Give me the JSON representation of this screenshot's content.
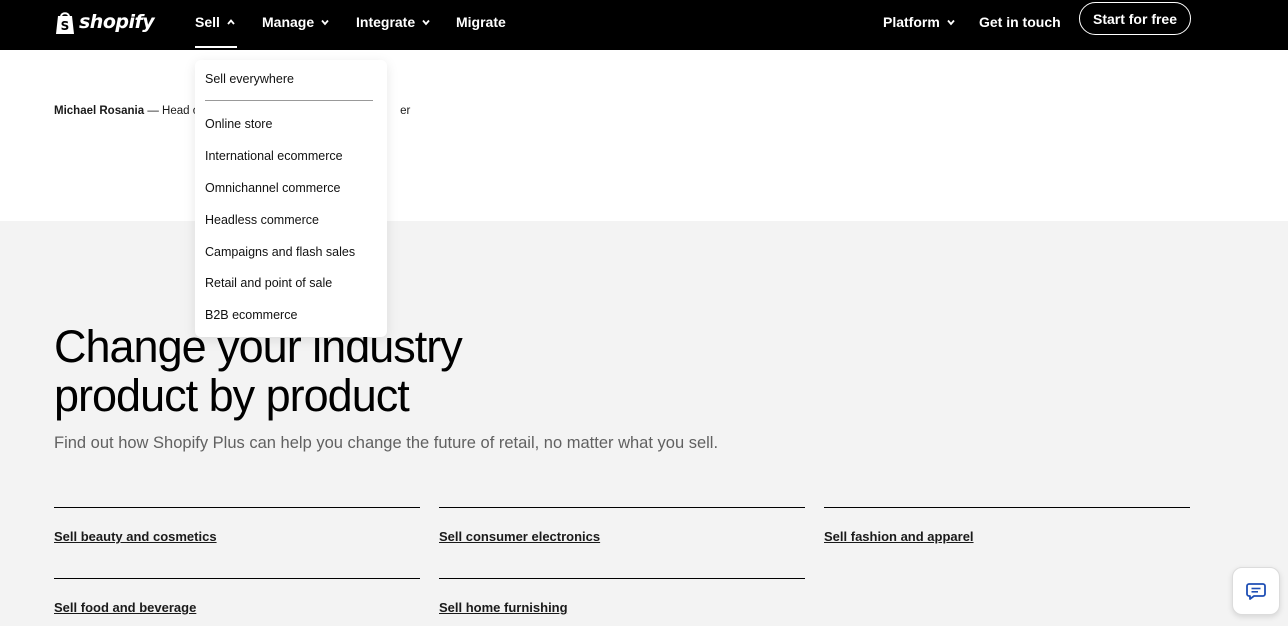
{
  "nav": {
    "logo_text": "shopify",
    "items": [
      {
        "label": "Sell"
      },
      {
        "label": "Manage"
      },
      {
        "label": "Integrate"
      },
      {
        "label": "Migrate"
      }
    ],
    "right": {
      "platform": "Platform",
      "contact": "Get in touch",
      "cta": "Start for free"
    }
  },
  "attribution": {
    "name": "Michael Rosania",
    "role_visible_start": " — Head o",
    "role_visible_end": "er"
  },
  "dropdown": {
    "top_item": "Sell everywhere",
    "items": [
      "Online store",
      "International ecommerce",
      "Omnichannel commerce",
      "Headless commerce",
      "Campaigns and flash sales",
      "Retail and point of sale",
      "B2B ecommerce"
    ]
  },
  "hero": {
    "headline_line1": "Change your industry",
    "headline_line2": "product by product",
    "subline": "Find out how Shopify Plus can help you change the future of retail, no matter what you sell."
  },
  "categories": [
    "Sell beauty and cosmetics",
    "Sell consumer electronics",
    "Sell fashion and apparel",
    "Sell food and beverage",
    "Sell home furnishing"
  ],
  "colors": {
    "nav_bg": "#000000",
    "page_bg": "#f3f3f3",
    "white_band": "#ffffff",
    "subtext": "#616161",
    "chat_icon": "#1f4fb5"
  },
  "icons": {
    "logo": "shopify-bag-icon",
    "open": "chevron-up-icon",
    "closed": "chevron-down-icon",
    "chat": "chat-icon"
  }
}
